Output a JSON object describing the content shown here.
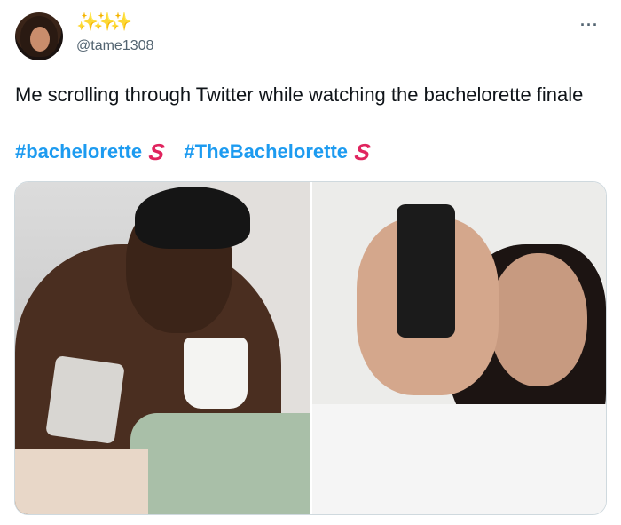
{
  "user": {
    "sparkles": [
      "✨",
      "✨",
      "✨"
    ],
    "handle": "@tame1308"
  },
  "more_menu": "···",
  "tweet": {
    "text": "Me scrolling through Twitter while watching the bachelorette finale",
    "hashtags": [
      {
        "label": "#bachelorette",
        "emoji": "S"
      },
      {
        "label": "#TheBachelorette",
        "emoji": "S"
      }
    ]
  },
  "media": {
    "count": 2
  },
  "colors": {
    "link": "#1d9bf0",
    "handle": "#536471",
    "hashtag_emoji": "#e0245e"
  }
}
